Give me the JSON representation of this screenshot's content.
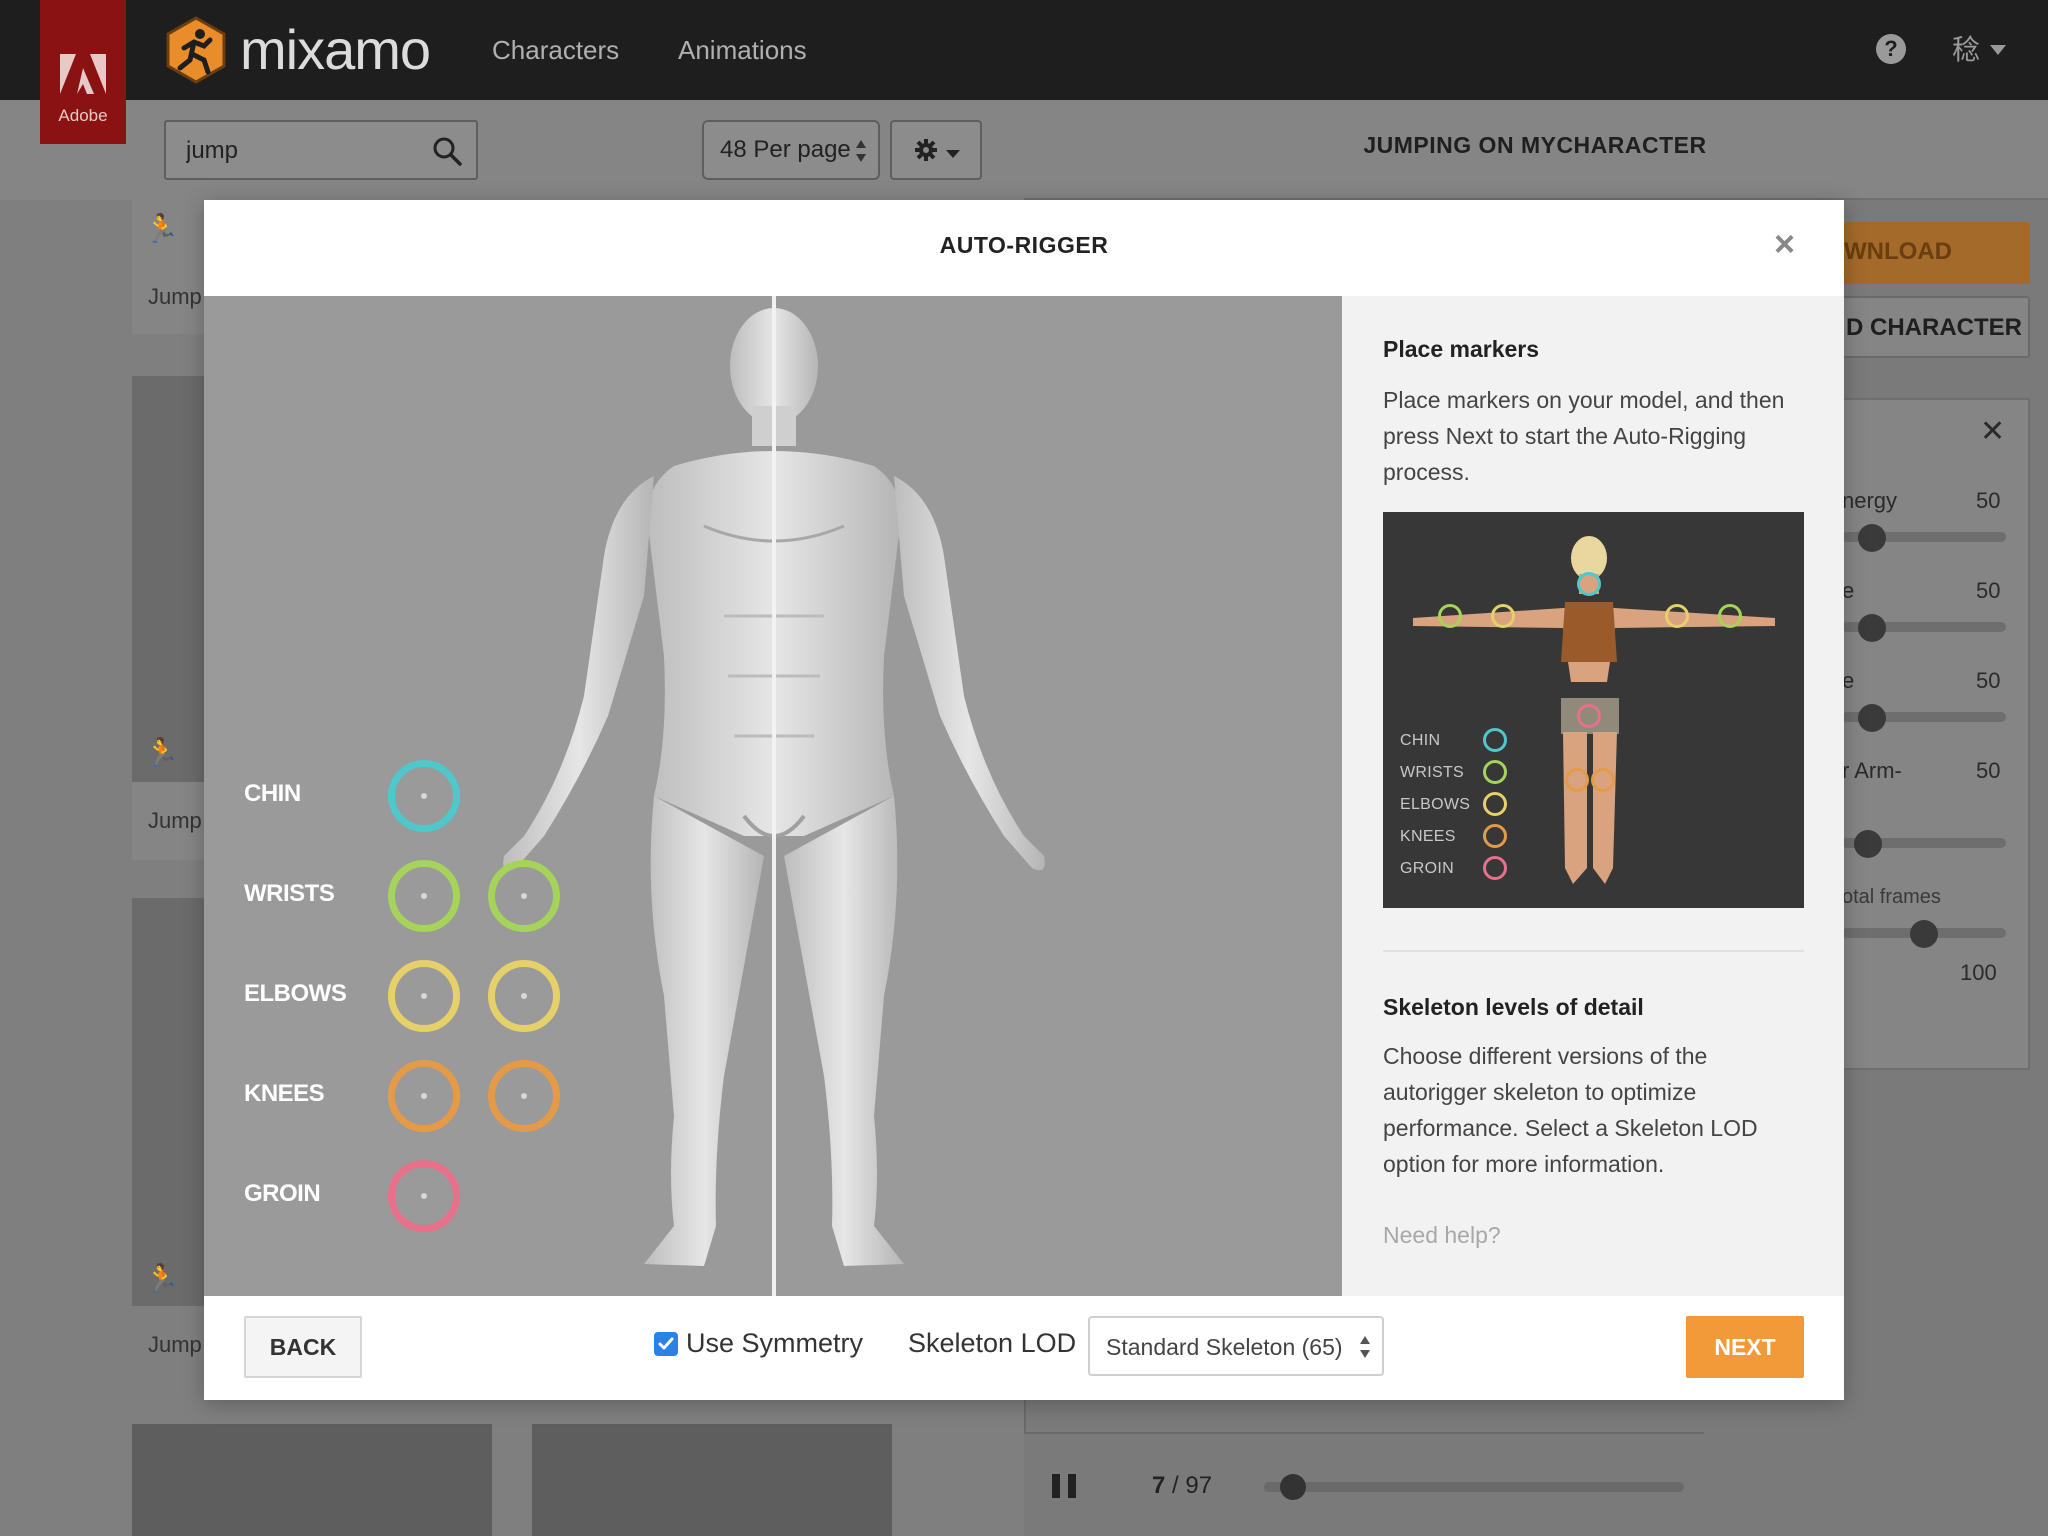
{
  "topbar": {
    "adobe_label": "Adobe",
    "brand": "mixamo",
    "nav": [
      "Characters",
      "Animations"
    ],
    "help_glyph": "?",
    "language_glyph": "稔"
  },
  "search": {
    "value": "jump",
    "placeholder": ""
  },
  "per_page": "48 Per page",
  "preview_panel": {
    "title": "JUMPING ON MYCHARACTER",
    "download_label": "WNLOAD",
    "upload_label": "D CHARACTER",
    "params": [
      {
        "label": "nergy",
        "value": "50",
        "level": 0.18
      },
      {
        "label": "e",
        "value": "50",
        "level": 0.18
      },
      {
        "label": "e",
        "value": "50",
        "level": 0.18
      },
      {
        "label": "r Arm-",
        "value": "50",
        "level": 0.16
      }
    ],
    "frames_label": "otal frames",
    "frames_value": "100",
    "frames_level": 0.5
  },
  "library": {
    "tile_label": "Jump"
  },
  "player": {
    "current_frame": "7",
    "separator": " / ",
    "total_frames": "97",
    "progress": 0.07
  },
  "modal": {
    "title": "AUTO-RIGGER",
    "close_glyph": "×",
    "markers": [
      {
        "label": "CHIN",
        "color": "#4fc8cc",
        "count": 1
      },
      {
        "label": "WRISTS",
        "color": "#a6d35a",
        "count": 2
      },
      {
        "label": "ELBOWS",
        "color": "#e6d06a",
        "count": 2
      },
      {
        "label": "KNEES",
        "color": "#e59a48",
        "count": 2
      },
      {
        "label": "GROIN",
        "color": "#e8708a",
        "count": 1
      }
    ],
    "sidebar": {
      "place_heading": "Place markers",
      "place_text": "Place markers on your model, and then press Next to start the Auto-Rigging process.",
      "lod_heading": "Skeleton levels of detail",
      "lod_text": "Choose different versions of the autorigger skeleton to optimize performance. Select a Skeleton LOD option for more information.",
      "help_link": "Need help?",
      "legend": [
        "CHIN",
        "WRISTS",
        "ELBOWS",
        "KNEES",
        "GROIN"
      ]
    },
    "footer": {
      "back_label": "BACK",
      "symmetry_label": "Use Symmetry",
      "symmetry_checked": true,
      "lod_label": "Skeleton LOD",
      "lod_value": "Standard Skeleton (65)",
      "next_label": "NEXT"
    }
  },
  "colors": {
    "accent": "#f29a3a",
    "checkbox": "#2b82e6",
    "adobe_red": "#8a1212"
  }
}
